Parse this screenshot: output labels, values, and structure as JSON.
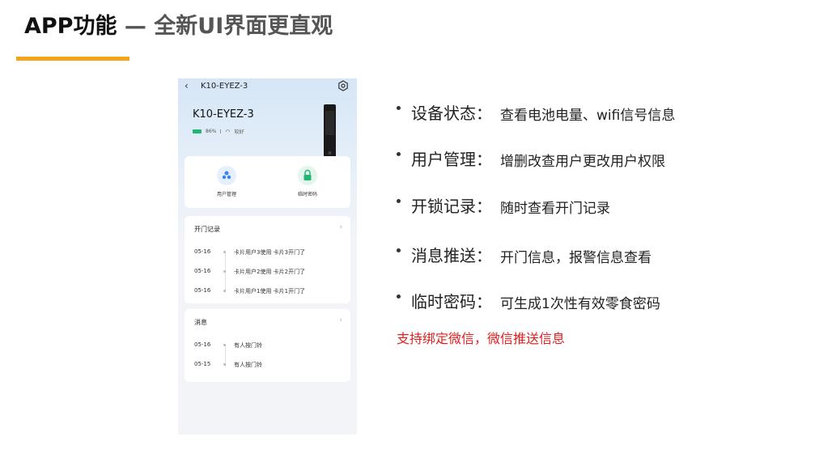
{
  "slide": {
    "title_main": "APP功能",
    "title_sub": " — 全新UI界面更直观",
    "accent_color": "#f5a31a"
  },
  "phone": {
    "nav_back_icon": "chevron-left-icon",
    "nav_title": "K10-EYEZ-3",
    "settings_icon": "gear-icon",
    "device_name": "K10-EYEZ-3",
    "battery": "86%",
    "battery_color": "#22b573",
    "wifi_status": "较好",
    "features": [
      {
        "label": "用户管理",
        "icon": "users-icon",
        "color": "#3b82f6"
      },
      {
        "label": "临时密码",
        "icon": "lock-icon",
        "color": "#22b573"
      }
    ],
    "records": {
      "title": "开门记录",
      "items": [
        {
          "date": "05-16",
          "text": "卡片用户3使用 卡片3开门了"
        },
        {
          "date": "05-16",
          "text": "卡片用户2使用 卡片2开门了"
        },
        {
          "date": "05-16",
          "text": "卡片用户1使用 卡片1开门了"
        }
      ]
    },
    "messages": {
      "title": "消息",
      "items": [
        {
          "date": "05-16",
          "text": "有人按门铃"
        },
        {
          "date": "05-15",
          "text": "有人按门铃"
        }
      ]
    }
  },
  "bullets": [
    {
      "label": "设备状态：",
      "desc": "查看电池电量、wifi信号信息"
    },
    {
      "label": "用户管理：",
      "desc": "增删改查用户更改用户权限"
    },
    {
      "label": "开锁记录：",
      "desc": "随时查看开门记录"
    },
    {
      "label": "消息推送：",
      "desc": "开门信息，报警信息查看"
    },
    {
      "label": "临时密码：",
      "desc": "可生成1次性有效零食密码"
    }
  ],
  "red_note": "支持绑定微信，微信推送信息"
}
